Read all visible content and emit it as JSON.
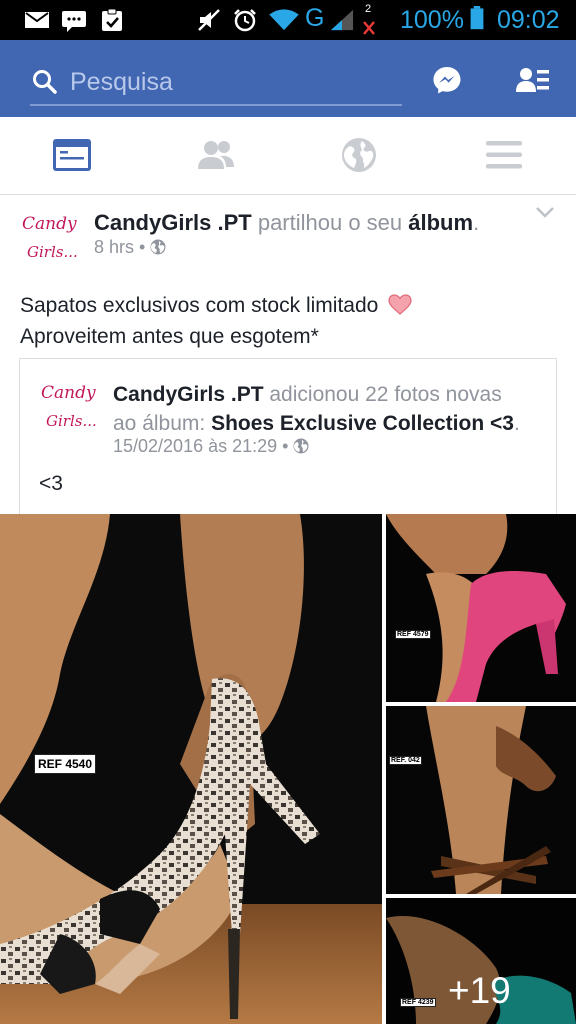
{
  "status_bar": {
    "battery": "100%",
    "time": "09:02",
    "network": "G",
    "notification_count": "2"
  },
  "header": {
    "search_placeholder": "Pesquisa"
  },
  "nav": [
    "news-feed",
    "friends",
    "notifications",
    "menu"
  ],
  "post": {
    "author": "CandyGirls .PT",
    "action": " partilhou o seu ",
    "object": "álbum",
    "period": ".",
    "time": "8 hrs",
    "privacy_sep": " • ",
    "message_line1": "Sapatos exclusivos com stock limitado",
    "message_line2": "Aproveitem antes que esgotem*"
  },
  "shared": {
    "author": "CandyGirls .PT",
    "action": " adicionou 22 fotos novas",
    "action2": "ao álbum: ",
    "album": "Shoes Exclusive Collection <3",
    "period": ".",
    "time": "15/02/2016 às 21:29",
    "privacy_sep": " • ",
    "text": "<3"
  },
  "avatar_text": {
    "line1": "Candy",
    "line2": "Girls..."
  },
  "photos": {
    "main_ref": "REF 4540",
    "ref2": "REF 4579",
    "ref3": "REF. 042",
    "ref4": "REF 4239",
    "more_count": "+19"
  },
  "colors": {
    "facebook_blue": "#4267b2",
    "status_blue": "#2aa7e6",
    "pink_shoe": "#e0457e",
    "teal_shoe": "#1aa39a"
  }
}
